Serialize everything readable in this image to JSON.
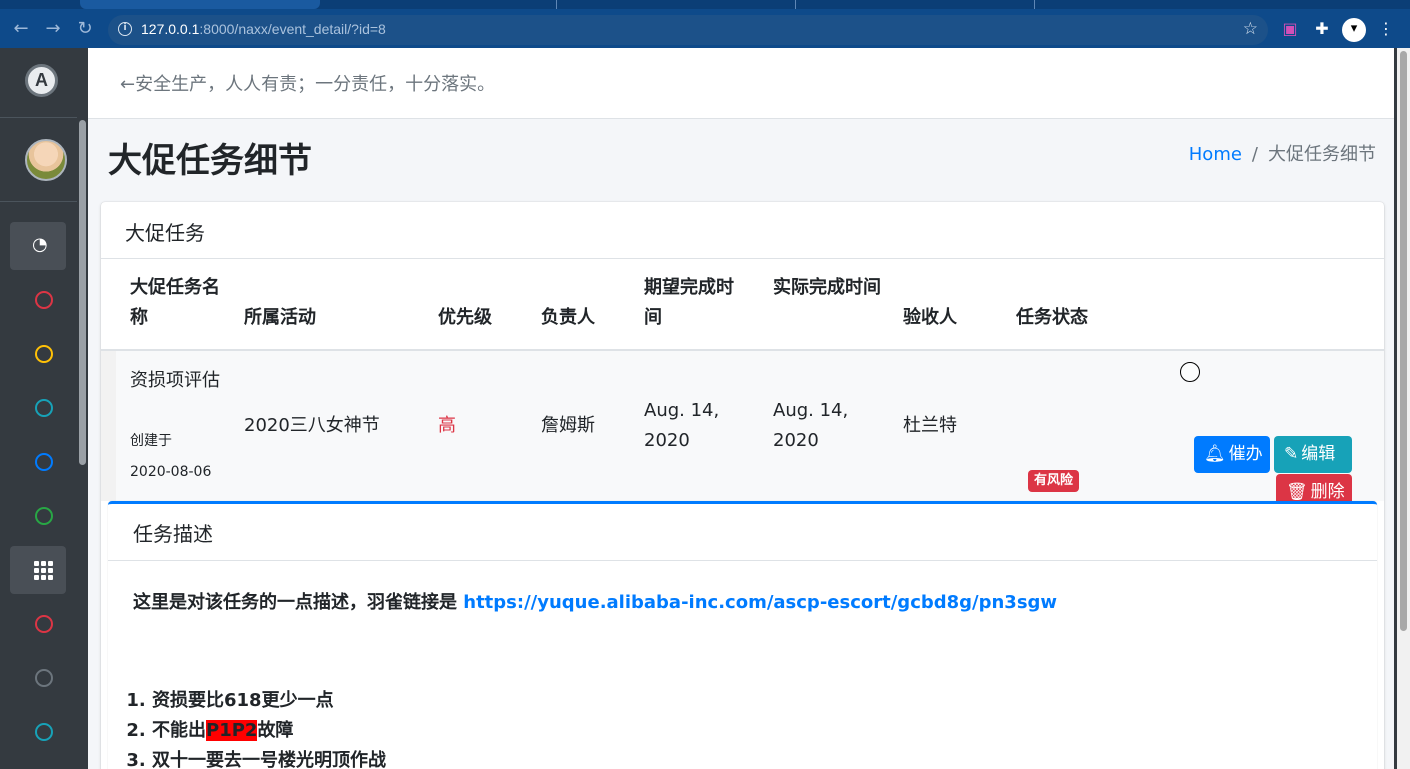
{
  "browser": {
    "url_host": "127.0.0.1",
    "url_path": ":8000/naxx/event_detail/?id=8"
  },
  "header": {
    "motto": "←安全生产，人人有责；一分责任，十分落实。"
  },
  "page": {
    "title": "大促任务细节",
    "breadcrumb_home": "Home",
    "breadcrumb_current": "大促任务细节"
  },
  "task_card": {
    "title": "大促任务",
    "columns": [
      "大促任务名称",
      "所属活动",
      "优先级",
      "负责人",
      "期望完成时间",
      "实际完成时间",
      "验收人",
      "任务状态"
    ],
    "row": {
      "name": "资损项评估",
      "created_label": "创建于",
      "created_date": "2020-08-06",
      "activity": "2020三八女神节",
      "priority": "高",
      "owner": "詹姆斯",
      "expected": "Aug. 14, 2020",
      "actual": "Aug. 14, 2020",
      "acceptor": "杜兰特",
      "status": "有风险"
    },
    "buttons": {
      "remind": "催办",
      "edit": "编辑",
      "delete": "删除"
    }
  },
  "description": {
    "title": "任务描述",
    "text": "这里是对该任务的一点描述，羽雀链接是 ",
    "link": "https://yuque.alibaba-inc.com/ascp-escort/gcbd8g/pn3sgw",
    "items": [
      {
        "prefix": "资损要比618更少一点"
      },
      {
        "prefix": "不能出",
        "highlight": "P1P2",
        "suffix": "故障"
      },
      {
        "prefix": "双十一要去一号楼光明顶作战"
      }
    ]
  },
  "colors": {
    "primary": "#007bff",
    "info": "#17a2b8",
    "danger": "#dc3545",
    "sidebar": "#343a40"
  }
}
